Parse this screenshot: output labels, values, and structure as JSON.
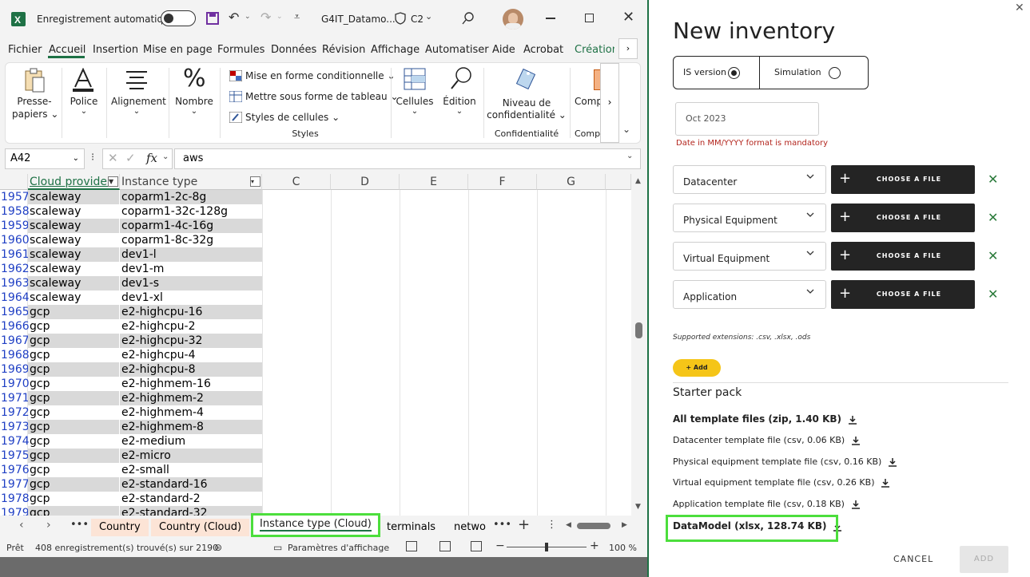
{
  "excel": {
    "titlebar": {
      "autosave_label": "Enregistrement automatique",
      "filename": "G4IT_Datamo...",
      "sensitivity": "C2"
    },
    "tabs": [
      "Fichier",
      "Accueil",
      "Insertion",
      "Mise en page",
      "Formules",
      "Données",
      "Révision",
      "Affichage",
      "Automatiser",
      "Aide",
      "Acrobat",
      "Création d"
    ],
    "active_tab": "Accueil",
    "ribbon": {
      "presse_papiers": "Presse-papiers",
      "presse_line1": "Presse-",
      "presse_line2": "papiers",
      "police": "Police",
      "alignement": "Alignement",
      "nombre": "Nombre",
      "mise_en_forme_cond": "Mise en forme conditionnelle",
      "mettre_sous_forme": "Mettre sous forme de tableau",
      "styles_cellules": "Styles de cellules",
      "styles_group": "Styles",
      "cellules": "Cellules",
      "edition": "Édition",
      "niveau_line1": "Niveau de",
      "niveau_line2": "confidentialité",
      "confidentialite_group": "Confidentialité",
      "comp": "Comp",
      "comp_group": "Comp"
    },
    "formula_bar": {
      "name_box": "A42",
      "fx": "fx",
      "value": "aws"
    },
    "columns": {
      "a_header": "Cloud provider",
      "b_header": "Instance type",
      "others": [
        "C",
        "D",
        "E",
        "F",
        "G"
      ]
    },
    "rows": [
      {
        "n": "1957",
        "provider": "scaleway",
        "type": "coparm1-2c-8g",
        "shaded": true
      },
      {
        "n": "1958",
        "provider": "scaleway",
        "type": "coparm1-32c-128g",
        "shaded": false
      },
      {
        "n": "1959",
        "provider": "scaleway",
        "type": "coparm1-4c-16g",
        "shaded": true
      },
      {
        "n": "1960",
        "provider": "scaleway",
        "type": "coparm1-8c-32g",
        "shaded": false
      },
      {
        "n": "1961",
        "provider": "scaleway",
        "type": "dev1-l",
        "shaded": true
      },
      {
        "n": "1962",
        "provider": "scaleway",
        "type": "dev1-m",
        "shaded": false
      },
      {
        "n": "1963",
        "provider": "scaleway",
        "type": "dev1-s",
        "shaded": true
      },
      {
        "n": "1964",
        "provider": "scaleway",
        "type": "dev1-xl",
        "shaded": false
      },
      {
        "n": "1965",
        "provider": "gcp",
        "type": "e2-highcpu-16",
        "shaded": true
      },
      {
        "n": "1966",
        "provider": "gcp",
        "type": "e2-highcpu-2",
        "shaded": false
      },
      {
        "n": "1967",
        "provider": "gcp",
        "type": "e2-highcpu-32",
        "shaded": true
      },
      {
        "n": "1968",
        "provider": "gcp",
        "type": "e2-highcpu-4",
        "shaded": false
      },
      {
        "n": "1969",
        "provider": "gcp",
        "type": "e2-highcpu-8",
        "shaded": true
      },
      {
        "n": "1970",
        "provider": "gcp",
        "type": "e2-highmem-16",
        "shaded": false
      },
      {
        "n": "1971",
        "provider": "gcp",
        "type": "e2-highmem-2",
        "shaded": true
      },
      {
        "n": "1972",
        "provider": "gcp",
        "type": "e2-highmem-4",
        "shaded": false
      },
      {
        "n": "1973",
        "provider": "gcp",
        "type": "e2-highmem-8",
        "shaded": true
      },
      {
        "n": "1974",
        "provider": "gcp",
        "type": "e2-medium",
        "shaded": false
      },
      {
        "n": "1975",
        "provider": "gcp",
        "type": "e2-micro",
        "shaded": true
      },
      {
        "n": "1976",
        "provider": "gcp",
        "type": "e2-small",
        "shaded": false
      },
      {
        "n": "1977",
        "provider": "gcp",
        "type": "e2-standard-16",
        "shaded": true
      },
      {
        "n": "1978",
        "provider": "gcp",
        "type": "e2-standard-2",
        "shaded": false
      },
      {
        "n": "1979",
        "provider": "gcp",
        "type": "e2-standard-32",
        "shaded": true
      }
    ],
    "sheet_tabs": [
      "Country",
      "Country (Cloud)",
      "Instance type (Cloud)",
      "terminals",
      "netwo"
    ],
    "active_sheet": "Instance type (Cloud)",
    "status": {
      "ready": "Prêt",
      "records": "408 enregistrement(s) trouvé(s) sur 2190",
      "display_settings": "Paramètres d'affichage",
      "zoom": "100 %"
    }
  },
  "panel": {
    "title": "New inventory",
    "radio_is": "IS version",
    "radio_sim": "Simulation",
    "radio_selected": "IS version",
    "date_value": "Oct 2023",
    "date_error": "Date in MM/YYYY format is mandatory",
    "file_rows": [
      {
        "type": "Datacenter",
        "button": "CHOOSE A FILE"
      },
      {
        "type": "Physical Equipment",
        "button": "CHOOSE A FILE"
      },
      {
        "type": "Virtual Equipment",
        "button": "CHOOSE A FILE"
      },
      {
        "type": "Application",
        "button": "CHOOSE A FILE"
      }
    ],
    "supported": "Supported extensions: .csv, .xlsx, .ods",
    "add_button": "+ Add",
    "starter_title": "Starter pack",
    "downloads": [
      {
        "label": "All template files (zip, 1.40 KB)",
        "bold": true
      },
      {
        "label": "Datacenter template file (csv, 0.06 KB)",
        "bold": false
      },
      {
        "label": "Physical equipment template file (csv, 0.16 KB)",
        "bold": false
      },
      {
        "label": "Virtual equipment template file (csv, 0.26 KB)",
        "bold": false
      },
      {
        "label": "Application template file (csv, 0.18 KB)",
        "bold": false
      },
      {
        "label": "DataModel (xlsx, 128.74 KB)",
        "bold": true
      }
    ],
    "cancel": "CANCEL",
    "add": "ADD",
    "close_icon": "close-icon",
    "colors": {
      "highlight_green": "#4cde3c",
      "error_red": "#b3261e",
      "add_yellow": "#f5c518",
      "excel_green": "#1e7145"
    }
  }
}
